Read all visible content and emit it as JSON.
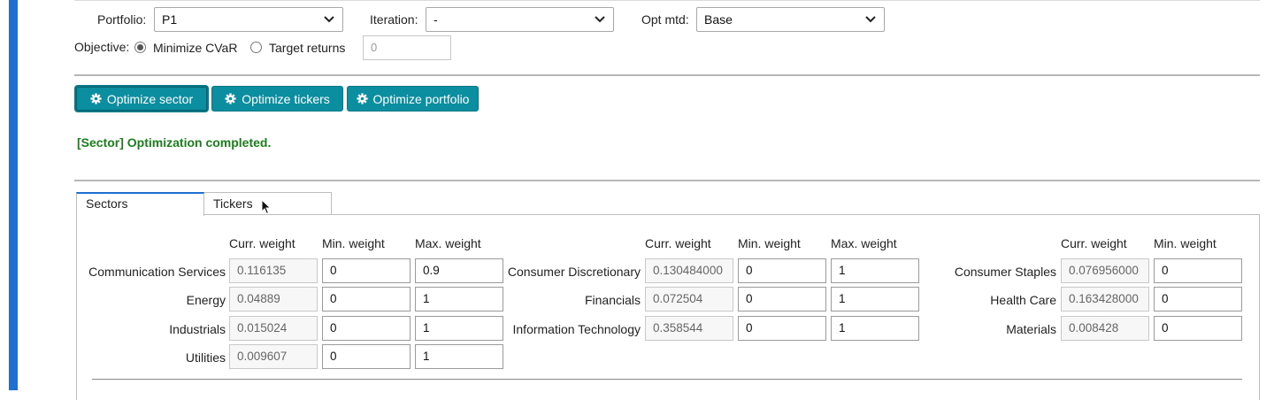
{
  "controls": {
    "portfolio_label": "Portfolio:",
    "portfolio_value": "P1",
    "iteration_label": "Iteration:",
    "iteration_value": "-",
    "opt_mtd_label": "Opt mtd:",
    "opt_mtd_value": "Base",
    "objective_label": "Objective:",
    "objective_options": [
      {
        "label": "Minimize CVaR",
        "selected": true
      },
      {
        "label": "Target returns",
        "selected": false
      }
    ],
    "target_returns_value": "0"
  },
  "buttons": {
    "optimize_sector": "Optimize sector",
    "optimize_tickers": "Optimize tickers",
    "optimize_portfolio": "Optimize portfolio"
  },
  "status_message": "[Sector] Optimization completed.",
  "tabs": [
    {
      "label": "Sectors",
      "active": true
    },
    {
      "label": "Tickers",
      "active": false
    }
  ],
  "column_headers": {
    "curr": "Curr. weight",
    "min": "Min. weight",
    "max": "Max. weight"
  },
  "sector_groups": [
    {
      "rows": [
        {
          "name": "Communication Services",
          "curr": "0.116135",
          "min": "0",
          "max": "0.9"
        },
        {
          "name": "Energy",
          "curr": "0.04889",
          "min": "0",
          "max": "1"
        },
        {
          "name": "Industrials",
          "curr": "0.015024",
          "min": "0",
          "max": "1"
        },
        {
          "name": "Utilities",
          "curr": "0.009607",
          "min": "0",
          "max": "1"
        }
      ]
    },
    {
      "rows": [
        {
          "name": "Consumer Discretionary",
          "curr": "0.130484000",
          "min": "0",
          "max": "1"
        },
        {
          "name": "Financials",
          "curr": "0.072504",
          "min": "0",
          "max": "1"
        },
        {
          "name": "Information Technology",
          "curr": "0.358544",
          "min": "0",
          "max": "1"
        }
      ]
    },
    {
      "rows": [
        {
          "name": "Consumer Staples",
          "curr": "0.076956000",
          "min": "0"
        },
        {
          "name": "Health Care",
          "curr": "0.163428000",
          "min": "0"
        },
        {
          "name": "Materials",
          "curr": "0.008428",
          "min": "0"
        }
      ]
    }
  ],
  "colors": {
    "accent_bar": "#1f6fd1",
    "button_bg": "#0b8ea0",
    "status_text": "#1a7f1a"
  }
}
